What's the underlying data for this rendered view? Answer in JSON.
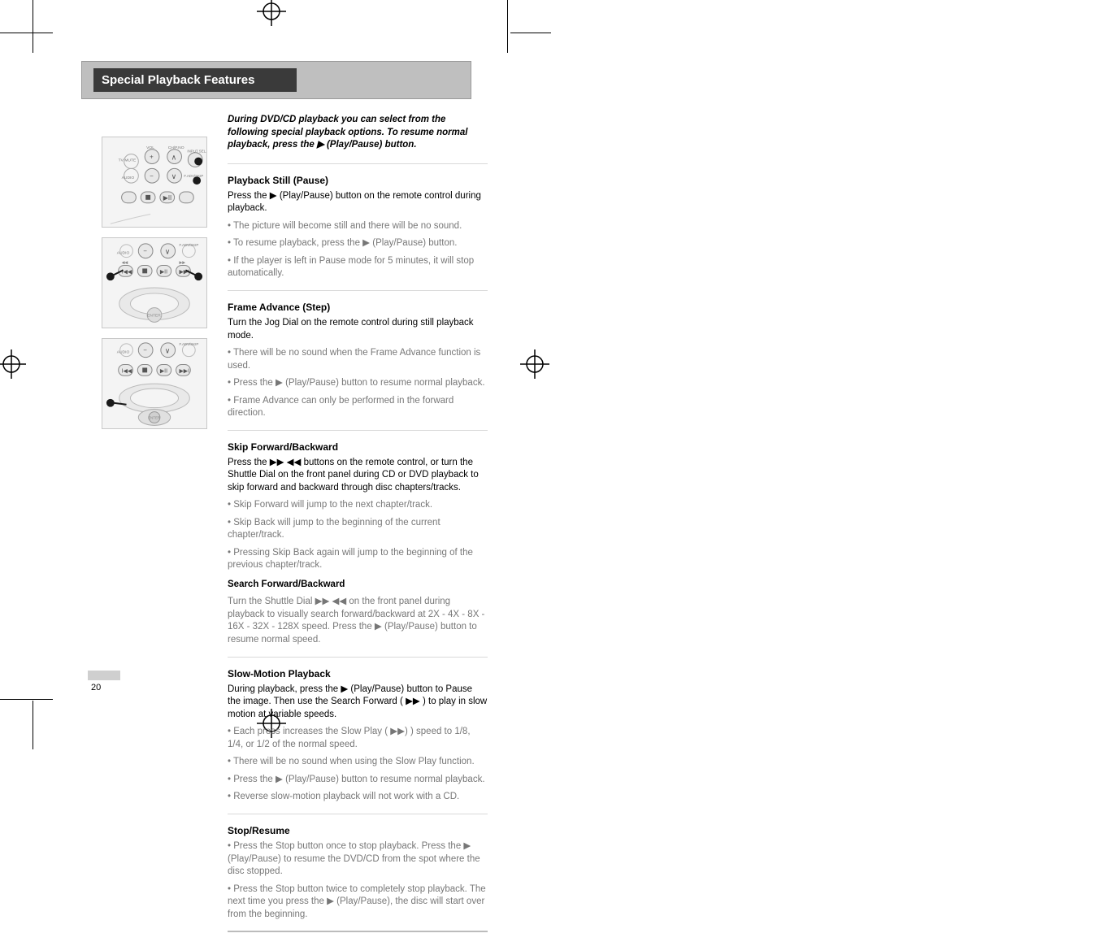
{
  "section_title": "Special Playback Features",
  "intro": "During DVD/CD playback you can select from the following special playback options. To resume normal playback, press the ▶ (Play/Pause) button.",
  "blocks": {
    "still": {
      "heading": "Playback Still (Pause)",
      "p1_a": "Press the ",
      "p1_b": " (Play/Pause) button on the remote control during playback.",
      "p2": "• The picture will become still and there will be no sound.",
      "p3_a": "• To resume playback, press the ",
      "p3_b": " (Play/Pause) button.",
      "p4": "• If the player is left in Pause mode for 5 minutes, it will stop automatically."
    },
    "advance": {
      "heading": "Frame Advance (Step)",
      "p1": "Turn the Jog Dial on the remote control during still playback mode.",
      "p2": "• There will be no sound when the Frame Advance function is used.",
      "p3_a": "• Press the ",
      "p3_b": " (Play/Pause) button to resume normal playback.",
      "p4": "• Frame Advance can only be performed in the forward direction."
    },
    "skip": {
      "heading": "Skip Forward/Backward",
      "p1_a": "Press the ",
      "p1_b": " buttons on the remote control, or turn the Shuttle Dial on the front panel during CD or DVD playback to skip forward and backward through disc chapters/tracks.",
      "p2": "• Skip Forward will jump to the next chapter/track.",
      "p3": "• Skip Back will jump to the beginning of the current chapter/track.",
      "p4": "• Pressing Skip Back again will jump to the beginning of the previous chapter/track.",
      "subheading": "Search Forward/Backward",
      "sp1_a": "Turn the Shuttle Dial ",
      "sp1_b": " on the front panel during playback to visually search forward/backward at 2X - 4X - 8X - 16X - 32X - 128X speed. Press the ",
      "sp1_c": " (Play/Pause) button to resume normal speed."
    },
    "slow": {
      "heading": "Slow-Motion Playback",
      "p1_a": "During playback, press the ",
      "p1_b": " (Play/Pause) button to Pause the image. Then use the Search Forward (",
      "p1_c": ") to play in slow motion at variable speeds.",
      "p2_a": "• Each press increases the Slow Play (",
      "p2_b": ") speed to 1/8, 1/4, or 1/2 of the normal speed.",
      "p3": "• There will be no sound when using the Slow Play function.",
      "p4_a": "• Press the ",
      "p4_b": " (Play/Pause) button to resume normal playback.",
      "p5": "• Reverse slow-motion playback will not work with a CD."
    },
    "stop": {
      "heading": "Stop/Resume",
      "p1_a": "• Press the Stop button once to stop playback. Press the ",
      "p1_b": " (Play/Pause) to resume the DVD/CD from the spot where the disc stopped.",
      "p2_a": "• Press the Stop button twice to completely stop playback. The next time you press the ",
      "p2_b": " (Play/Pause), the disc will start over from the beginning."
    }
  },
  "glyphs": {
    "play": "▶",
    "ff": "▶▶",
    "rw": "◀◀",
    "ff_rw": "▶▶ ◀◀"
  },
  "page_number": "20",
  "images": {
    "remote_top": "remote-top-illustration",
    "remote_mid": "remote-mid-illustration",
    "remote_bottom": "remote-bottom-illustration"
  }
}
